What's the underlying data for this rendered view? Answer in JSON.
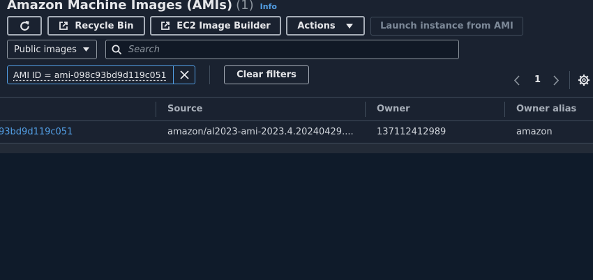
{
  "header": {
    "title": "Amazon Machine Images (AMIs)",
    "count": "(1)",
    "info_link": "Info"
  },
  "toolbar": {
    "refresh_icon": "refresh-icon",
    "recycle_bin_label": "Recycle Bin",
    "image_builder_label": "EC2 Image Builder",
    "external_icon": "external-link-icon",
    "actions_label": "Actions",
    "launch_label": "Launch instance from AMI"
  },
  "filters": {
    "visibility_value": "Public images",
    "search_placeholder": "Search",
    "token_text": "AMI ID = ami-098c93bd9d119c051",
    "clear_filters_label": "Clear filters"
  },
  "pagination": {
    "current_page": "1"
  },
  "table": {
    "columns": [
      "Source",
      "Owner",
      "Owner alias"
    ],
    "rows": [
      {
        "ami_id_visible": "93bd9d119c051",
        "source": "amazon/al2023-ami-2023.4.20240429....",
        "owner": "137112412989",
        "owner_alias": "amazon"
      }
    ]
  },
  "colors": {
    "background": "#0f1b2a",
    "panel": "#1a2230",
    "accent": "#539fe5",
    "border": "#a7aeb8",
    "text": "#e6e7ea"
  }
}
